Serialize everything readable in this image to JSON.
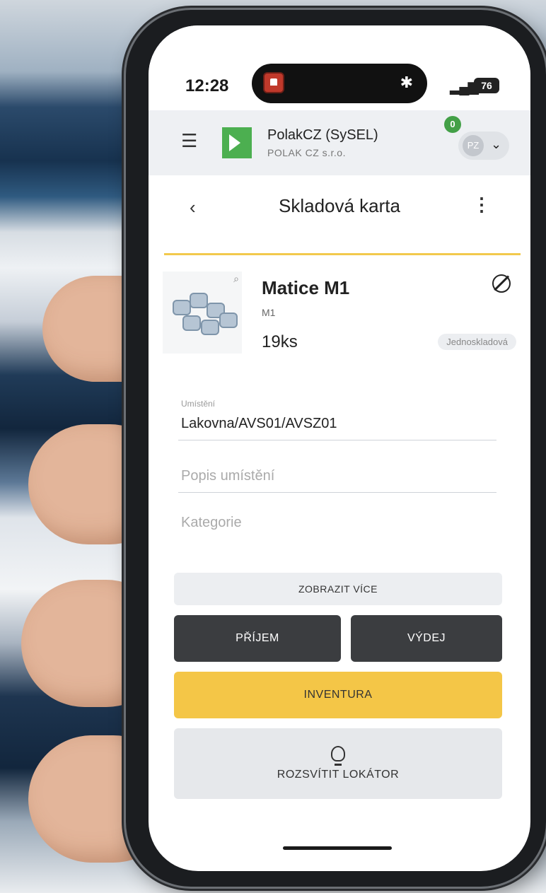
{
  "status_bar": {
    "time": "12:28",
    "battery": "76"
  },
  "app_bar": {
    "company_name": "PolakCZ (SySEL)",
    "company_sub": "POLAK CZ s.r.o.",
    "notification_count": "0",
    "user_initials": "PZ"
  },
  "page": {
    "title": "Skladová karta"
  },
  "product": {
    "name": "Matice M1",
    "code": "M1",
    "quantity": "19ks",
    "tag": "Jednoskladová"
  },
  "fields": {
    "location_label": "Umístění",
    "location_value": "Lakovna/AVS01/AVSZ01",
    "location_desc_placeholder": "Popis umístění",
    "category_placeholder": "Kategorie"
  },
  "buttons": {
    "show_more": "ZOBRAZIT VÍCE",
    "receive": "PŘÍJEM",
    "issue": "VÝDEJ",
    "inventory": "INVENTURA",
    "locator": "ROZSVÍTIT LOKÁTOR"
  },
  "colors": {
    "accent_yellow": "#f4c647",
    "dark_button": "#3b3d40",
    "logo_green": "#4caf50"
  }
}
